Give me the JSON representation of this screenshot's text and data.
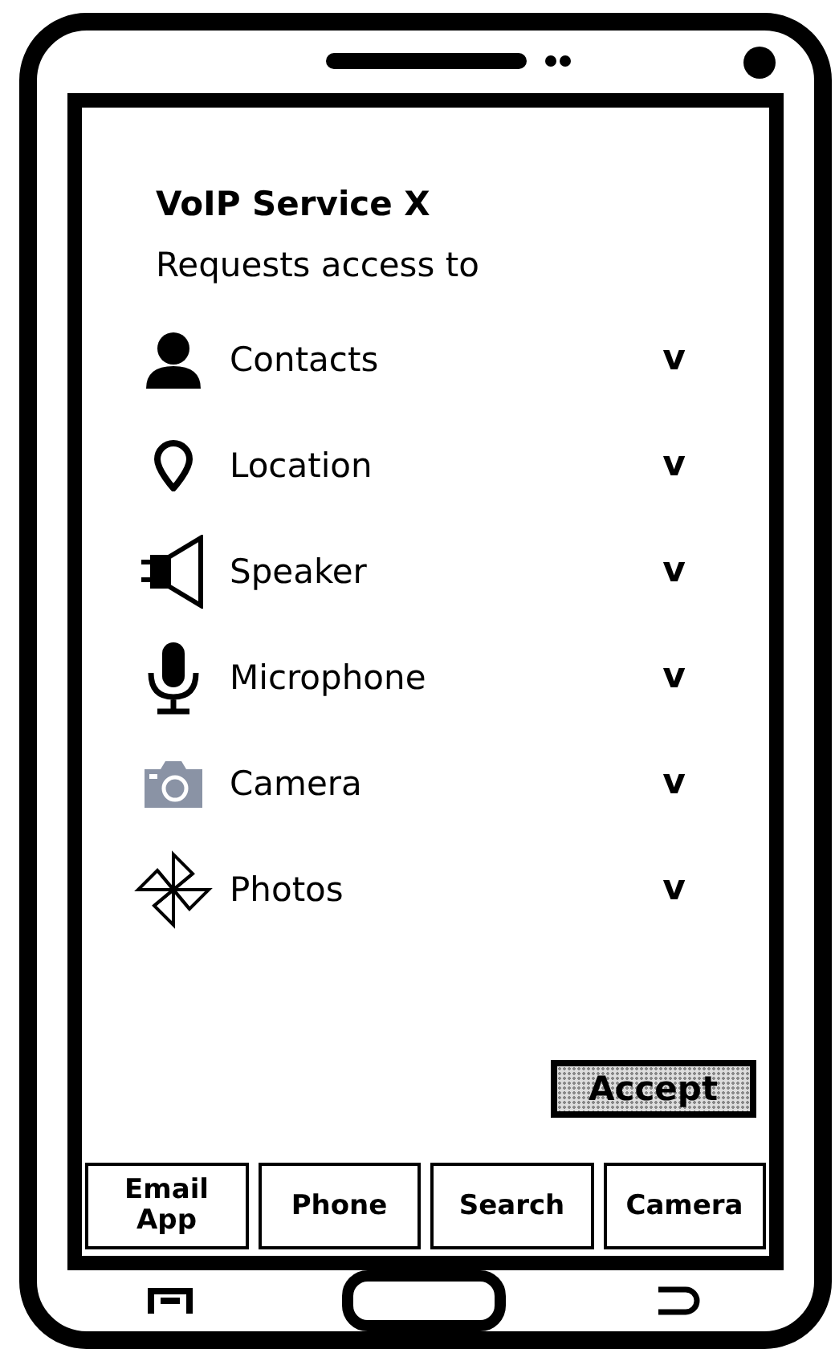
{
  "app": {
    "title": "VoIP Service X",
    "subtitle": "Requests access to"
  },
  "permissions": [
    {
      "kind": "contacts",
      "label": "Contacts",
      "mark": "v"
    },
    {
      "kind": "location",
      "label": "Location",
      "mark": "v"
    },
    {
      "kind": "speaker",
      "label": "Speaker",
      "mark": "v"
    },
    {
      "kind": "microphone",
      "label": "Microphone",
      "mark": "v"
    },
    {
      "kind": "camera",
      "label": "Camera",
      "mark": "v"
    },
    {
      "kind": "photos",
      "label": "Photos",
      "mark": "v"
    }
  ],
  "accept_button": "Accept",
  "bottom_buttons": [
    "Email App",
    "Phone",
    "Search",
    "Camera"
  ]
}
